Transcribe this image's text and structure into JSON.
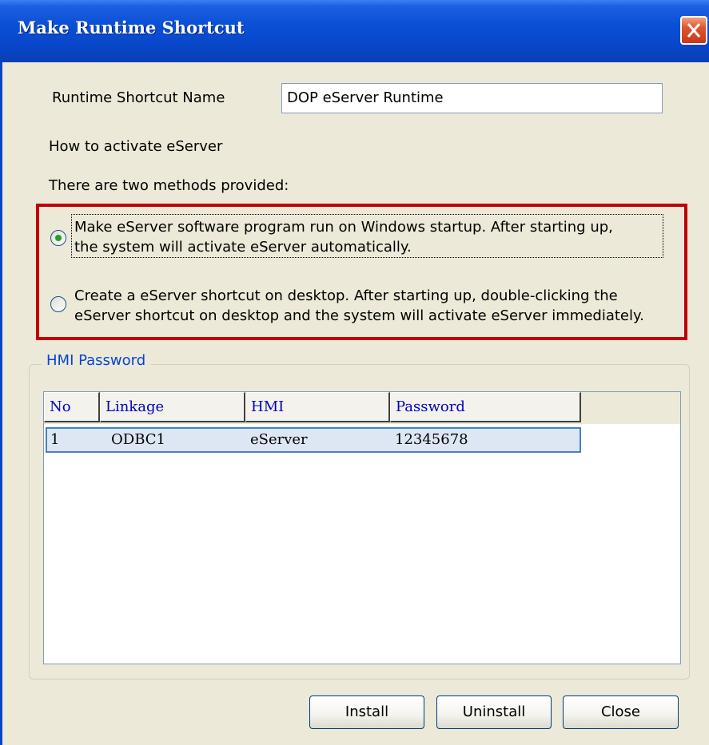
{
  "window": {
    "title": "Make Runtime Shortcut"
  },
  "form": {
    "shortcut_name_label": "Runtime Shortcut Name",
    "shortcut_name_value": "DOP eServer Runtime",
    "activate_heading": "How to activate eServer",
    "methods_heading": "There are two methods provided:",
    "options": [
      {
        "line1": "Make eServer software program run on Windows startup. After starting up,",
        "line2": "the system will activate eServer automatically.",
        "selected": true
      },
      {
        "line1": "Create a eServer shortcut on desktop. After starting up, double-clicking the",
        "line2": "eServer shortcut on desktop and the system will activate eServer immediately.",
        "selected": false
      }
    ]
  },
  "hmi_password": {
    "group_label": "HMI Password",
    "columns": [
      "No",
      "Linkage",
      "HMI",
      "Password"
    ],
    "rows": [
      {
        "no": "1",
        "linkage": "ODBC1",
        "hmi": "eServer",
        "password": "12345678"
      }
    ]
  },
  "buttons": {
    "install": "Install",
    "uninstall": "Uninstall",
    "close": "Close"
  },
  "colors": {
    "titlebar": "#0846c8",
    "highlight_box": "#c00000",
    "selected_row": "#dde7f4",
    "group_label": "#0046d5"
  }
}
